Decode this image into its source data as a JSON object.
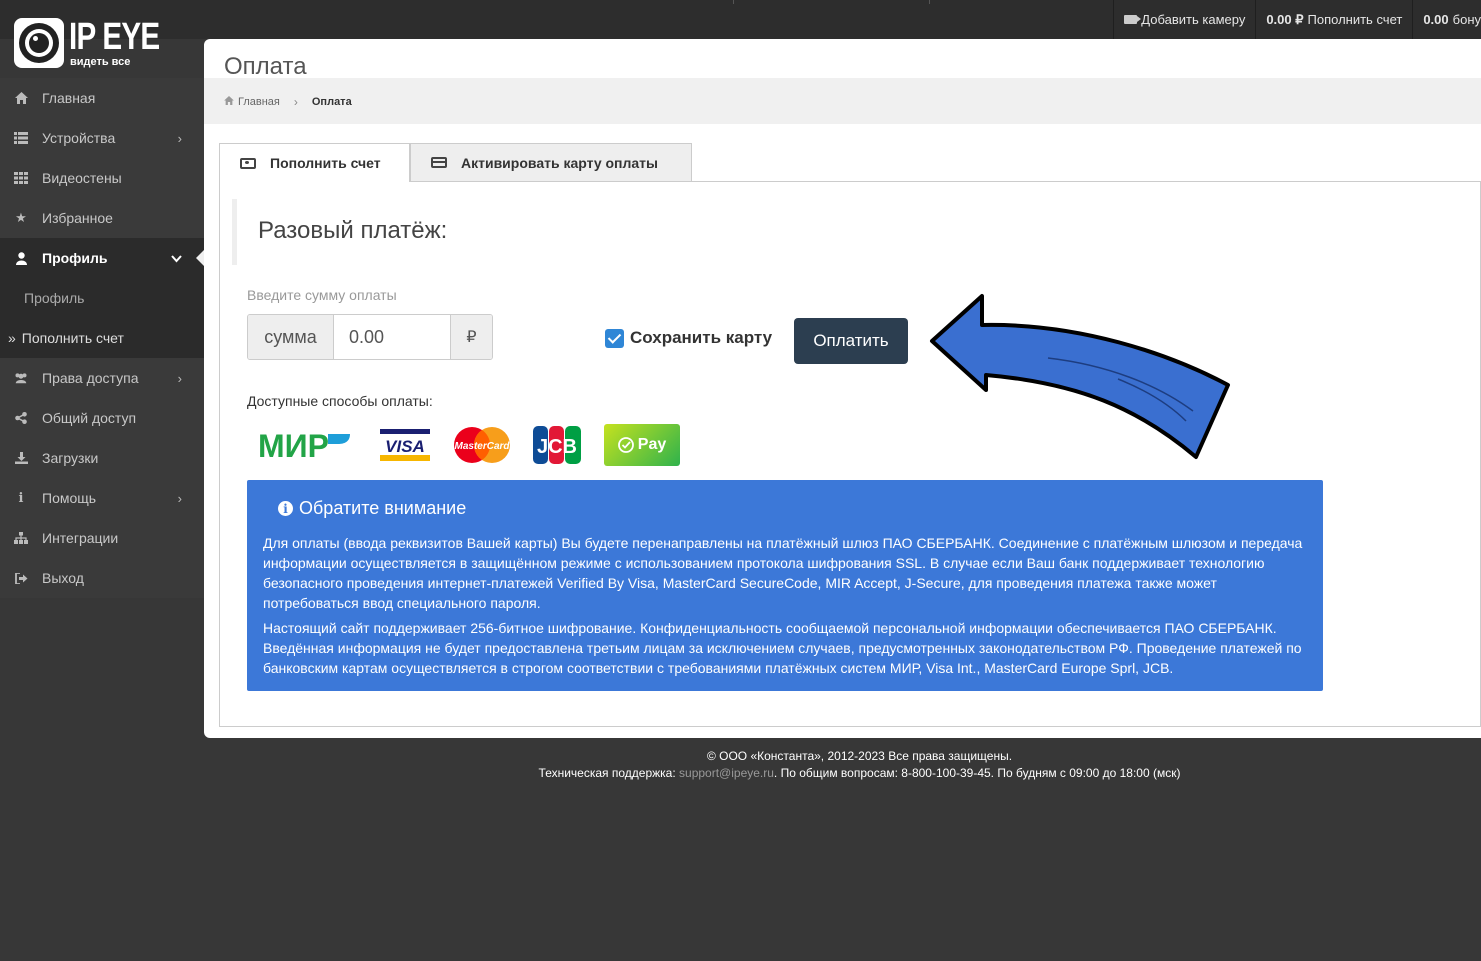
{
  "topbar": {
    "add_camera": "Добавить камеру",
    "balance_value": "0.00 ₽",
    "balance_label": "Пополнить счет",
    "bonus_value": "0.00",
    "bonus_label": "бону"
  },
  "logo": {
    "brand": "IP EYE",
    "tagline": "видеть все"
  },
  "sidebar": {
    "items": [
      {
        "label": "Главная",
        "icon": "home-icon"
      },
      {
        "label": "Устройства",
        "icon": "list-icon"
      },
      {
        "label": "Видеостены",
        "icon": "grid-icon"
      },
      {
        "label": "Избранное",
        "icon": "star-icon"
      },
      {
        "label": "Профиль",
        "icon": "user-icon"
      },
      {
        "label": "Профиль",
        "icon": ""
      },
      {
        "label": "Пополнить счет",
        "icon": ""
      },
      {
        "label": "Права доступа",
        "icon": "users-icon"
      },
      {
        "label": "Общий доступ",
        "icon": "share-icon"
      },
      {
        "label": "Загрузки",
        "icon": "download-icon"
      },
      {
        "label": "Помощь",
        "icon": "info-icon"
      },
      {
        "label": "Интеграции",
        "icon": "sitemap-icon"
      },
      {
        "label": "Выход",
        "icon": "logout-icon"
      }
    ]
  },
  "page": {
    "title": "Оплата"
  },
  "breadcrumb": {
    "home": "Главная",
    "current": "Оплата"
  },
  "tabs": [
    {
      "label": "Пополнить счет",
      "icon": "money-icon",
      "active": true
    },
    {
      "label": "Активировать карту оплаты",
      "icon": "credit-card-icon",
      "active": false
    }
  ],
  "payment": {
    "heading": "Разовый платёж:",
    "amount_label": "Введите сумму оплаты",
    "amount_prefix": "сумма",
    "amount_value": "0.00",
    "currency": "₽",
    "save_card_label": "Сохранить карту",
    "save_card_checked": true,
    "pay_button": "Оплатить",
    "methods_label": "Доступные способы оплаты:",
    "methods": [
      "МИР",
      "VISA",
      "MasterCard",
      "JCB",
      "Pay"
    ]
  },
  "notice": {
    "title": "Обратите внимание",
    "p1": "Для оплаты (ввода реквизитов Вашей карты) Вы будете перенаправлены на платёжный шлюз ПАО СБЕРБАНК. Соединение с платёжным шлюзом и передача информации осуществляется в защищённом режиме с использованием протокола шифрования SSL. В случае если Ваш банк поддерживает технологию безопасного проведения интернет-платежей Verified By Visa, MasterCard SecureCode, MIR Accept, J-Secure, для проведения платежа также может потребоваться ввод специального пароля.",
    "p2": "Настоящий сайт поддерживает 256-битное шифрование. Конфиденциальность сообщаемой персональной информации обеспечивается ПАО СБЕРБАНК. Введённая информация не будет предоставлена третьим лицам за исключением случаев, предусмотренных законодательством РФ. Проведение платежей по банковским картам осуществляется в строгом соответствии с требованиями платёжных систем МИР, Visa Int., MasterCard Europe Sprl, JCB."
  },
  "footer": {
    "copyright": "© ООО «Константа», 2012-2023 Все права защищены.",
    "support_prefix": "Техническая поддержка:",
    "support_email": "support@ipeye.ru",
    "support_suffix": ". По общим вопросам: 8-800-100-39-45. По будням с 09:00 до 18:00 (мск)"
  },
  "colors": {
    "accent": "#2c3e50",
    "notice_bg": "#3c78d8",
    "arrow": "#3a6fd0",
    "checkbox": "#2f86d6"
  }
}
